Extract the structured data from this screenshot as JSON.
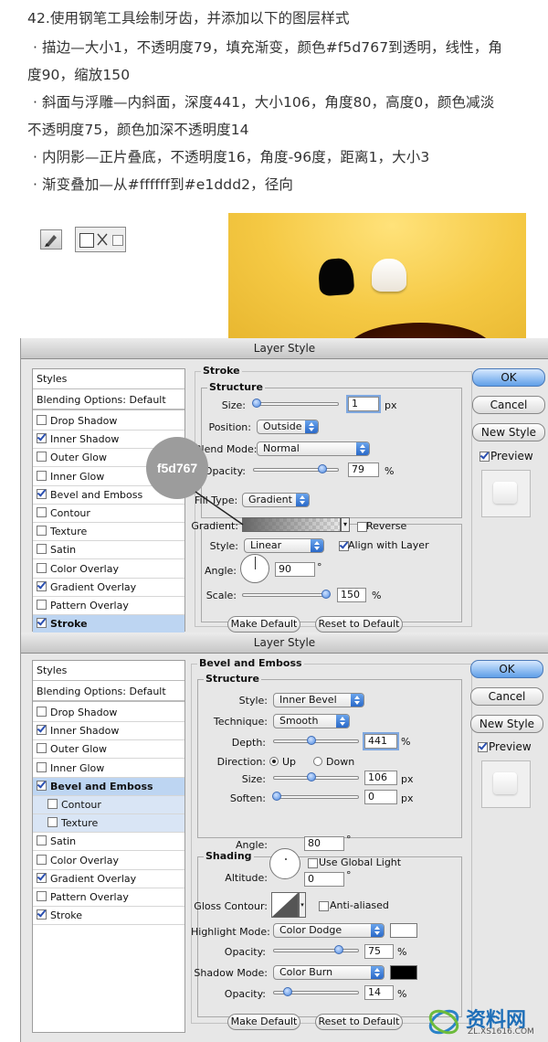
{
  "tutorial": {
    "heading": "42.使用钢笔工具绘制牙齿，并添加以下的图层样式",
    "line1a": "· 描边—大小1，不透明度79，填充渐变，颜色#f5d767到透明，线性，角",
    "line1b": "度90，缩放150",
    "line2a": "· 斜面与浮雕—内斜面，深度441，大小106，角度80，高度0，颜色减淡",
    "line2b": "不透明度75，颜色加深不透明度14",
    "line3": "· 内阴影—正片叠底，不透明度16，角度-96度，距离1，大小3",
    "line4": "· 渐变叠加—从#ffffff到#e1ddd2，径向"
  },
  "icons": {
    "pen": "pen-tool-icon",
    "shape_layers": "shape-layers-icon",
    "paths": "paths-icon",
    "fill_pixels": "fill-pixels-icon"
  },
  "callout": "f5d767",
  "dialog1": {
    "title": "Layer Style",
    "styles_header": "Styles",
    "blending": "Blending Options: Default",
    "items": [
      {
        "label": "Drop Shadow",
        "checked": false
      },
      {
        "label": "Inner Shadow",
        "checked": true
      },
      {
        "label": "Outer Glow",
        "checked": false
      },
      {
        "label": "Inner Glow",
        "checked": false
      },
      {
        "label": "Bevel and Emboss",
        "checked": true
      },
      {
        "label": "Contour",
        "checked": false
      },
      {
        "label": "Texture",
        "checked": false
      },
      {
        "label": "Satin",
        "checked": false
      },
      {
        "label": "Color Overlay",
        "checked": false
      },
      {
        "label": "Gradient Overlay",
        "checked": true
      },
      {
        "label": "Pattern Overlay",
        "checked": false
      },
      {
        "label": "Stroke",
        "checked": true
      }
    ],
    "section": "Stroke",
    "structure": "Structure",
    "size_label": "Size:",
    "size_value": "1",
    "size_unit": "px",
    "position_label": "Position:",
    "position_value": "Outside",
    "blend_label": "Blend Mode:",
    "blend_value": "Normal",
    "opacity_label": "Opacity:",
    "opacity_value": "79",
    "opacity_unit": "%",
    "filltype_label": "Fill Type:",
    "filltype_value": "Gradient",
    "gradient_label": "Gradient:",
    "reverse_label": "Reverse",
    "style_label": "Style:",
    "style_value": "Linear",
    "align_label": "Align with Layer",
    "angle_label": "Angle:",
    "angle_value": "90",
    "angle_unit": "°",
    "scale_label": "Scale:",
    "scale_value": "150",
    "scale_unit": "%",
    "make_default": "Make Default",
    "reset_default": "Reset to Default",
    "ok": "OK",
    "cancel": "Cancel",
    "new_style": "New Style",
    "preview": "Preview"
  },
  "dialog2": {
    "title": "Layer Style",
    "styles_header": "Styles",
    "blending": "Blending Options: Default",
    "items": [
      {
        "label": "Drop Shadow",
        "checked": false
      },
      {
        "label": "Inner Shadow",
        "checked": true
      },
      {
        "label": "Outer Glow",
        "checked": false
      },
      {
        "label": "Inner Glow",
        "checked": false
      },
      {
        "label": "Bevel and Emboss",
        "checked": true
      },
      {
        "label": "Contour",
        "checked": false
      },
      {
        "label": "Texture",
        "checked": false
      },
      {
        "label": "Satin",
        "checked": false
      },
      {
        "label": "Color Overlay",
        "checked": false
      },
      {
        "label": "Gradient Overlay",
        "checked": true
      },
      {
        "label": "Pattern Overlay",
        "checked": false
      },
      {
        "label": "Stroke",
        "checked": true
      }
    ],
    "section": "Bevel and Emboss",
    "structure": "Structure",
    "style_label": "Style:",
    "style_value": "Inner Bevel",
    "technique_label": "Technique:",
    "technique_value": "Smooth",
    "depth_label": "Depth:",
    "depth_value": "441",
    "depth_unit": "%",
    "direction_label": "Direction:",
    "dir_up": "Up",
    "dir_down": "Down",
    "size_label": "Size:",
    "size_value": "106",
    "size_unit": "px",
    "soften_label": "Soften:",
    "soften_value": "0",
    "soften_unit": "px",
    "shading": "Shading",
    "angle_label": "Angle:",
    "angle_value": "80",
    "angle_unit": "°",
    "global_light": "Use Global Light",
    "altitude_label": "Altitude:",
    "altitude_value": "0",
    "altitude_unit": "°",
    "gloss_label": "Gloss Contour:",
    "anti_aliased": "Anti-aliased",
    "highlight_label": "Highlight Mode:",
    "highlight_value": "Color Dodge",
    "highlight_color": "#ffffff",
    "hopacity_label": "Opacity:",
    "hopacity_value": "75",
    "hopacity_unit": "%",
    "shadow_label": "Shadow Mode:",
    "shadow_value": "Color Burn",
    "shadow_color": "#000000",
    "sopacity_label": "Opacity:",
    "sopacity_value": "14",
    "sopacity_unit": "%",
    "make_default": "Make Default",
    "reset_default": "Reset to Default",
    "ok": "OK",
    "cancel": "Cancel",
    "new_style": "New Style",
    "preview": "Preview"
  },
  "watermark": {
    "text": "资料网",
    "sub": "ZL.XS1616.COM"
  }
}
